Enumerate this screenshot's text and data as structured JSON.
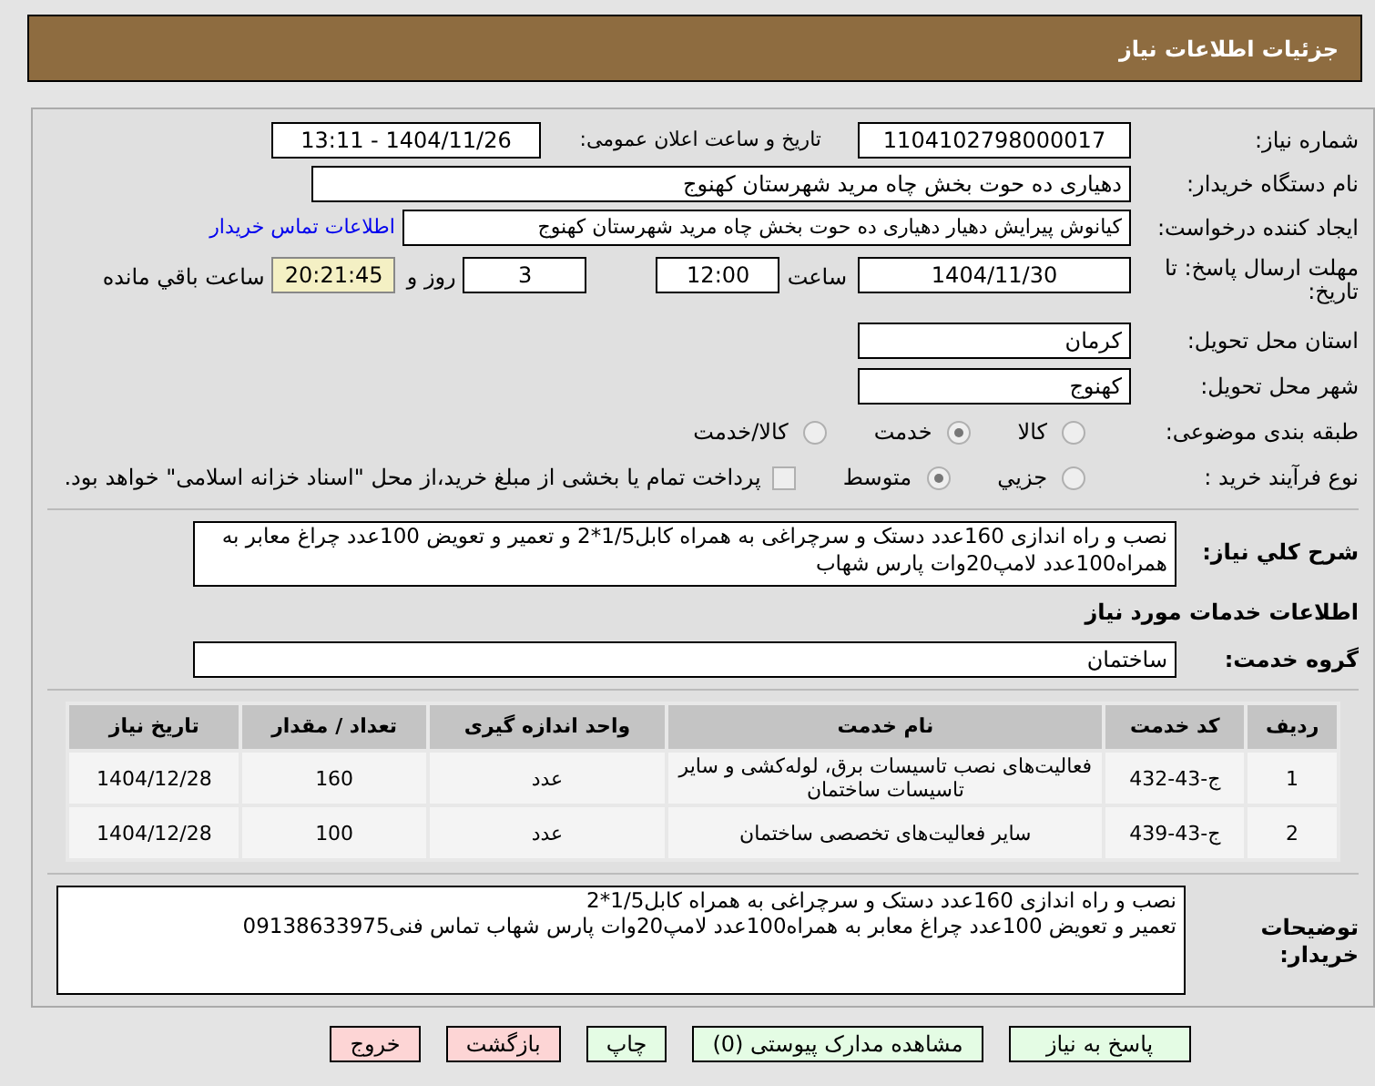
{
  "header": {
    "title": "جزئیات اطلاعات نیاز"
  },
  "need_number": {
    "label": "شماره نیاز:",
    "value": "1104102798000017"
  },
  "announce": {
    "label": "تاریخ و ساعت اعلان عمومی:",
    "value": "1404/11/26 - 13:11"
  },
  "buyer_org": {
    "label": "نام دستگاه خریدار:",
    "value": "دهیاری ده حوت بخش چاه مرید شهرستان کهنوج"
  },
  "requester": {
    "label": "ایجاد کننده درخواست:",
    "value": "کیانوش پیرایش دهیار دهیاری ده حوت بخش چاه مرید شهرستان کهنوج",
    "link": "اطلاعات تماس خریدار"
  },
  "deadline": {
    "label": "مهلت ارسال پاسخ: تا تاریخ:",
    "date": "1404/11/30",
    "time_label": "ساعت",
    "time": "12:00",
    "days": "3",
    "days_label": "روز و",
    "remaining": "20:21:45",
    "remaining_label": "ساعت باقي مانده"
  },
  "province": {
    "label": "استان محل تحویل:",
    "value": "کرمان"
  },
  "city": {
    "label": "شهر محل تحویل:",
    "value": "کهنوج"
  },
  "category": {
    "label": "طبقه بندی موضوعی:",
    "options": [
      {
        "label": "کالا",
        "selected": false
      },
      {
        "label": "خدمت",
        "selected": true
      },
      {
        "label": "کالا/خدمت",
        "selected": false
      }
    ]
  },
  "process": {
    "label": "نوع فرآیند خرید :",
    "options": [
      {
        "label": "جزیي",
        "selected": false
      },
      {
        "label": "متوسط",
        "selected": true
      }
    ],
    "payment": {
      "checked": false,
      "text": "پرداخت تمام یا بخشی از مبلغ خرید،از محل \"اسناد خزانه اسلامی\" خواهد بود."
    }
  },
  "summary": {
    "label": "شرح کلي نیاز:",
    "value": "نصب و راه اندازی 160عدد دستک و سرچراغی به همراه کابل1/5*2 و تعمیر و تعویض 100عدد چراغ معابر به همراه100عدد لامپ20وات پارس شهاب"
  },
  "services_title": "اطلاعات خدمات مورد نیاز",
  "service_group": {
    "label": "گروه خدمت:",
    "value": "ساختمان"
  },
  "table": {
    "columns": [
      "ردیف",
      "کد خدمت",
      "نام خدمت",
      "واحد اندازه گیری",
      "تعداد / مقدار",
      "تاریخ نیاز"
    ],
    "rows": [
      [
        "1",
        "ج-43-432",
        "فعالیت‌های نصب تاسیسات برق، لوله‌کشی و سایر تاسیسات ساختمان",
        "عدد",
        "160",
        "1404/12/28"
      ],
      [
        "2",
        "ج-43-439",
        "سایر فعالیت‌های تخصصی ساختمان",
        "عدد",
        "100",
        "1404/12/28"
      ]
    ]
  },
  "buyer_notes": {
    "label": "توضیحات خریدار:",
    "value": "نصب و راه اندازی 160عدد دستک و سرچراغی به همراه کابل1/5*2\nتعمیر و تعویض 100عدد چراغ معابر به همراه100عدد لامپ20وات پارس شهاب تماس فنی09138633975"
  },
  "buttons": [
    {
      "label": "پاسخ به نیاز",
      "kind": "action"
    },
    {
      "label": "مشاهده مدارک پیوستی (0)",
      "kind": "action"
    },
    {
      "label": "چاپ",
      "kind": "action"
    },
    {
      "label": "بازگشت",
      "kind": "exit"
    },
    {
      "label": "خروج",
      "kind": "exit"
    }
  ]
}
